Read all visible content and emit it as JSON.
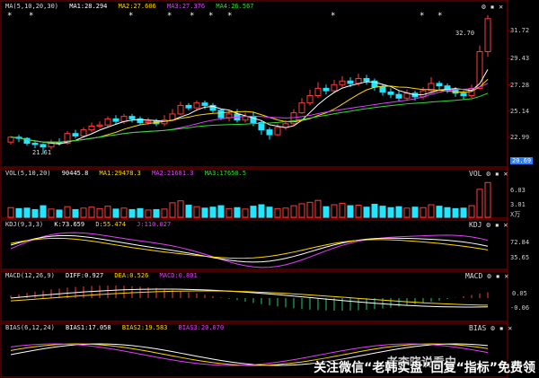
{
  "main": {
    "ma_label": "MA(5,10,20,30)",
    "ma1": "MA1:28.294",
    "ma2": "MA2:27.606",
    "ma3": "MA3:27.376",
    "ma4": "MA4:26.567",
    "price_high_label": "32.70",
    "price_low_label": "21.61",
    "current_price": "20.69",
    "yticks": [
      "31.72",
      "29.43",
      "27.28",
      "25.14",
      "22.99"
    ]
  },
  "vol": {
    "label": "VOL(5,10,20)",
    "v": "90445.8",
    "ma1": "MA1:29478.3",
    "ma2": "MA2:21681.3",
    "ma3": "MA3:17650.5",
    "tag": "VOL",
    "yticks": [
      "6.03",
      "3.01",
      "X万"
    ]
  },
  "kdj": {
    "label": "KDJ(9,3,3)",
    "k": "K:73.659",
    "d": "D:55.474",
    "j": "J:110.027",
    "tag": "KDJ",
    "yticks": [
      "72.84",
      "35.65"
    ]
  },
  "macd": {
    "label": "MACD(12,26,9)",
    "diff": "DIFF:0.927",
    "dea": "DEA:0.526",
    "macd": "MACD:0.801",
    "tag": "MACD",
    "yticks": [
      "0.05",
      "-0.06"
    ]
  },
  "bias": {
    "label": "BIAS(6,12,24)",
    "b1": "BIAS1:17.058",
    "b2": "BIAS2:19.583",
    "b3": "BIAS3:20.070",
    "tag": "BIAS"
  },
  "watermark": "关注微信“老韩实盘”回复“指标”免费领",
  "brand": "老李晓说看中",
  "colors": {
    "up": "#ff3a3a",
    "down": "#22e6ff",
    "ma1": "#ffffff",
    "ma2": "#ffd700",
    "ma3": "#e040fb",
    "ma4": "#33dd33"
  },
  "chart_data": {
    "type": "candlestick",
    "ylim": [
      21.0,
      33.2
    ],
    "candles": [
      [
        22.6,
        23.0,
        22.4,
        23.1
      ],
      [
        23.0,
        22.9,
        22.6,
        23.2
      ],
      [
        22.9,
        22.5,
        22.3,
        23.0
      ],
      [
        22.5,
        22.4,
        22.1,
        22.7
      ],
      [
        22.4,
        22.2,
        21.6,
        22.5
      ],
      [
        22.2,
        22.6,
        22.0,
        22.8
      ],
      [
        22.6,
        22.5,
        22.3,
        22.9
      ],
      [
        22.5,
        23.3,
        22.4,
        23.5
      ],
      [
        23.3,
        23.1,
        22.9,
        23.6
      ],
      [
        23.1,
        23.6,
        23.0,
        23.8
      ],
      [
        23.6,
        23.9,
        23.4,
        24.2
      ],
      [
        23.9,
        24.0,
        23.7,
        24.3
      ],
      [
        24.0,
        24.5,
        23.8,
        24.7
      ],
      [
        24.5,
        24.3,
        24.1,
        24.8
      ],
      [
        24.3,
        24.7,
        24.1,
        24.9
      ],
      [
        24.7,
        24.5,
        24.2,
        24.9
      ],
      [
        24.5,
        24.2,
        24.0,
        24.7
      ],
      [
        24.2,
        24.3,
        24.0,
        24.6
      ],
      [
        24.3,
        24.1,
        23.9,
        24.5
      ],
      [
        24.1,
        24.4,
        23.9,
        24.8
      ],
      [
        24.4,
        24.9,
        24.3,
        25.3
      ],
      [
        24.9,
        25.6,
        24.8,
        25.9
      ],
      [
        25.6,
        25.4,
        25.2,
        25.8
      ],
      [
        25.4,
        25.8,
        25.2,
        26.0
      ],
      [
        25.8,
        25.6,
        25.3,
        26.0
      ],
      [
        25.6,
        25.2,
        25.0,
        25.8
      ],
      [
        25.2,
        24.6,
        24.4,
        25.3
      ],
      [
        24.6,
        24.9,
        24.3,
        25.2
      ],
      [
        24.9,
        24.4,
        24.2,
        25.3
      ],
      [
        24.4,
        24.7,
        24.2,
        25.0
      ],
      [
        24.7,
        24.2,
        23.9,
        25.1
      ],
      [
        24.2,
        23.6,
        23.2,
        24.4
      ],
      [
        23.6,
        23.2,
        22.8,
        23.8
      ],
      [
        23.2,
        23.8,
        23.1,
        24.1
      ],
      [
        23.8,
        24.1,
        23.6,
        24.4
      ],
      [
        24.1,
        25.0,
        24.0,
        25.3
      ],
      [
        25.0,
        25.8,
        24.9,
        26.2
      ],
      [
        25.8,
        26.4,
        25.6,
        26.9
      ],
      [
        26.4,
        27.0,
        26.2,
        27.5
      ],
      [
        27.0,
        26.8,
        26.5,
        27.3
      ],
      [
        26.8,
        27.3,
        26.6,
        27.7
      ],
      [
        27.3,
        27.6,
        27.1,
        28.0
      ],
      [
        27.6,
        27.4,
        27.1,
        27.9
      ],
      [
        27.4,
        27.8,
        27.2,
        28.2
      ],
      [
        27.8,
        27.6,
        27.3,
        28.1
      ],
      [
        27.6,
        27.1,
        26.8,
        27.8
      ],
      [
        27.1,
        26.7,
        26.4,
        27.3
      ],
      [
        26.7,
        26.5,
        26.2,
        27.0
      ],
      [
        26.5,
        26.2,
        25.9,
        26.8
      ],
      [
        26.2,
        26.6,
        26.0,
        26.9
      ],
      [
        26.6,
        26.3,
        26.0,
        26.8
      ],
      [
        26.3,
        26.8,
        26.1,
        27.1
      ],
      [
        26.8,
        27.4,
        26.6,
        27.9
      ],
      [
        27.4,
        27.2,
        26.9,
        27.6
      ],
      [
        27.2,
        26.9,
        26.6,
        27.4
      ],
      [
        26.9,
        26.6,
        26.3,
        27.1
      ],
      [
        26.6,
        26.4,
        26.1,
        26.8
      ],
      [
        26.4,
        27.0,
        26.2,
        27.3
      ],
      [
        27.0,
        30.0,
        26.9,
        30.5
      ],
      [
        30.0,
        32.7,
        29.6,
        33.0
      ]
    ],
    "volume": [
      2.0,
      1.8,
      1.9,
      1.6,
      2.4,
      1.7,
      1.5,
      2.2,
      1.6,
      1.9,
      2.1,
      1.8,
      2.3,
      1.7,
      1.9,
      1.6,
      1.8,
      1.5,
      1.6,
      1.7,
      3.0,
      3.4,
      2.5,
      2.2,
      1.9,
      2.1,
      2.4,
      1.8,
      2.0,
      1.7,
      2.3,
      2.6,
      2.1,
      1.8,
      1.9,
      2.4,
      2.8,
      3.1,
      3.5,
      2.2,
      2.6,
      2.9,
      2.4,
      2.5,
      2.1,
      2.7,
      2.3,
      2.0,
      2.2,
      1.9,
      2.1,
      2.0,
      2.6,
      2.3,
      2.0,
      1.8,
      1.9,
      2.4,
      5.8,
      7.2
    ]
  }
}
